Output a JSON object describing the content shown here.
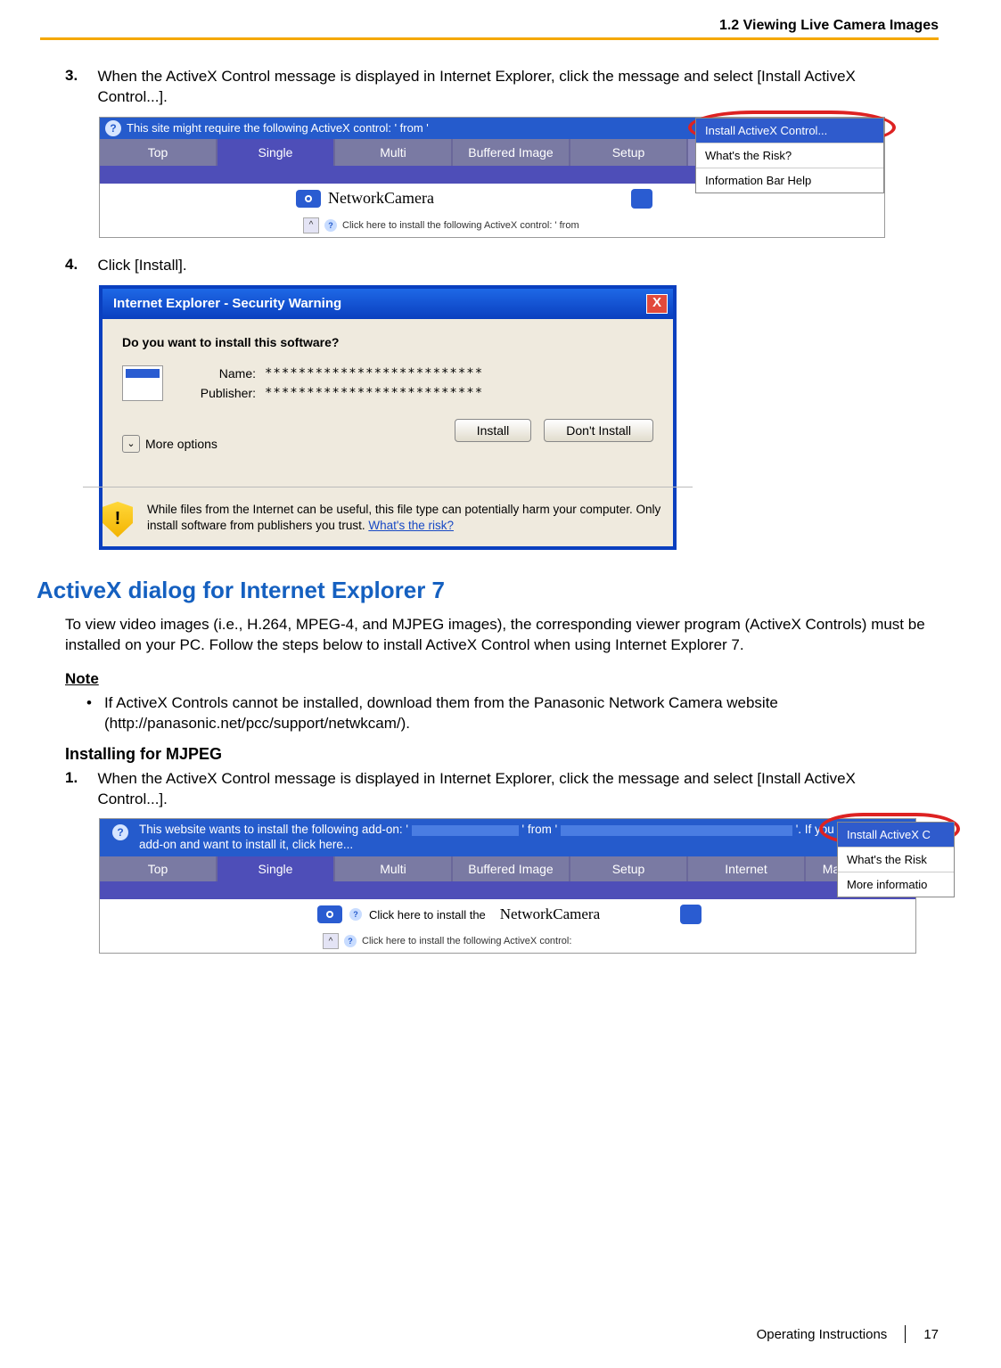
{
  "header": {
    "section": "1.2 Viewing Live Camera Images"
  },
  "step3": {
    "num": "3.",
    "text": "When the ActiveX Control message is displayed in Internet Explorer, click the message and select [Install ActiveX Control...]."
  },
  "ss1": {
    "infobar": "This site might require the following ActiveX control:                       ' from '",
    "menu": {
      "install": "Install ActiveX Control...",
      "risk": "What's the Risk?",
      "help": "Information Bar Help"
    },
    "tabs": [
      "Top",
      "Single",
      "Multi",
      "Buffered Image",
      "Setup"
    ],
    "camera_label": "NetworkCamera",
    "click_here": "Click here to install the following ActiveX control:                ' from"
  },
  "step4": {
    "num": "4.",
    "text": "Click [Install]."
  },
  "dlg": {
    "title": "Internet Explorer - Security Warning",
    "question": "Do you want to install this software?",
    "name_label": "Name:",
    "name_value": "**************************",
    "pub_label": "Publisher:",
    "pub_value": "**************************",
    "more": "More options",
    "install_btn": "Install",
    "dont_btn": "Don't Install",
    "warn_text": "While files from the Internet can be useful, this file type can potentially harm your computer. Only install software from publishers you trust. ",
    "warn_link": "What's the risk?"
  },
  "section_heading": "ActiveX dialog for Internet Explorer 7",
  "intro": "To view video images (i.e., H.264, MPEG-4, and MJPEG images), the corresponding viewer program (ActiveX Controls) must be installed on your PC. Follow the steps below to install ActiveX Control when using Internet Explorer 7.",
  "note_label": "Note",
  "note_bullet": "If ActiveX Controls cannot be installed, download them from the Panasonic Network Camera website (http://panasonic.net/pcc/support/netwkcam/).",
  "subheading": "Installing for MJPEG",
  "step1": {
    "num": "1.",
    "text": "When the ActiveX Control message is displayed in Internet Explorer, click the message and select [Install ActiveX Control...]."
  },
  "ss3": {
    "infobar_l1": "This website wants to install the following add-on: '",
    "infobar_mid": "' from '",
    "infobar_tail": "'. If you",
    "infobar_l2": "add-on and want to install it, click here...",
    "menu": {
      "install": "Install ActiveX C",
      "risk": "What's the Risk",
      "more": "More informatio"
    },
    "tabs": [
      "Top",
      "Single",
      "Multi",
      "Buffered Image",
      "Setup",
      "Internet",
      "Mai"
    ],
    "camera_label": "NetworkCamera",
    "click_text1": "Click here to install the",
    "click_text2": "Click here to install the following ActiveX control:"
  },
  "footer": {
    "doc": "Operating Instructions",
    "page": "17"
  }
}
